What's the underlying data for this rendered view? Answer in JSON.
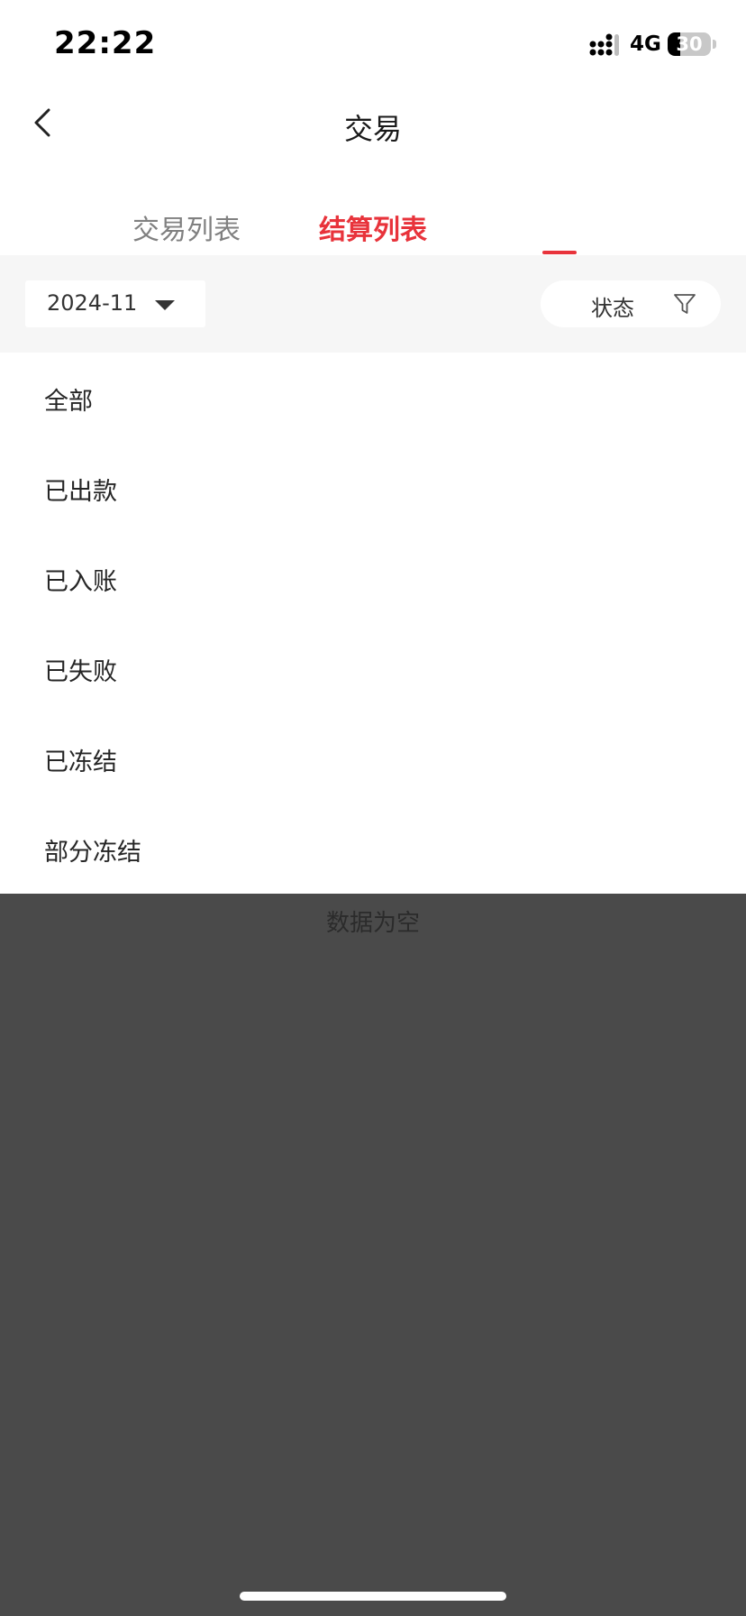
{
  "status_bar": {
    "time": "22:22",
    "network": "4G",
    "battery": "30",
    "battery_fraction": 0.3
  },
  "nav": {
    "title": "交易",
    "back_icon": "chevron-left-icon"
  },
  "tabs": [
    {
      "label": "交易列表",
      "active": false
    },
    {
      "label": "结算列表",
      "active": true
    }
  ],
  "filters": {
    "date": "2024-11",
    "status_label": "状态",
    "status_icon": "funnel-icon"
  },
  "status_menu": {
    "items": [
      {
        "label": "全部"
      },
      {
        "label": "已出款"
      },
      {
        "label": "已入账"
      },
      {
        "label": "已失败"
      },
      {
        "label": "已冻结"
      },
      {
        "label": "部分冻结"
      }
    ]
  },
  "empty_state": {
    "text": "数据为空"
  },
  "colors": {
    "accent": "#e8333b",
    "overlay": "#4a4a4a",
    "filter_bar_bg": "#f6f6f6"
  }
}
